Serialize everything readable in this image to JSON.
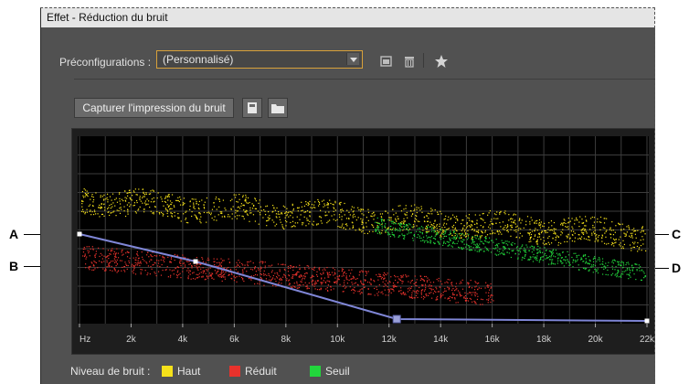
{
  "window": {
    "title": "Effet - Réduction du bruit"
  },
  "presets": {
    "label": "Préconfigurations :",
    "value": "(Personnalisé)"
  },
  "toolbar": {
    "icons": [
      "save-preset-icon",
      "delete-preset-icon",
      "favorite-star-icon"
    ]
  },
  "capture": {
    "label": "Capturer l'impression du bruit",
    "icons": [
      "save-file-icon",
      "open-folder-icon"
    ]
  },
  "callouts": [
    "A",
    "B",
    "C",
    "D"
  ],
  "legend": {
    "label": "Niveau de bruit :",
    "items": [
      {
        "label": "Haut",
        "color": "#f5e11a"
      },
      {
        "label": "Réduit",
        "color": "#e8322c"
      },
      {
        "label": "Seuil",
        "color": "#22d63c"
      }
    ]
  },
  "colors": {
    "panel": "#515151",
    "graph_bg": "#000000",
    "grid": "#3c3c3c",
    "curve": "#7f86d6",
    "accent_border": "#d8a13a"
  },
  "chart_data": {
    "type": "scatter",
    "x_unit": "Hz",
    "x_ticks": [
      "Hz",
      "2k",
      "4k",
      "6k",
      "8k",
      "10k",
      "12k",
      "14k",
      "16k",
      "18k",
      "20k",
      "22k"
    ],
    "xlim": [
      0,
      22000
    ],
    "grid": true,
    "series": [
      {
        "name": "Haut",
        "color": "#f5e11a"
      },
      {
        "name": "Réduit",
        "color": "#e8322c"
      },
      {
        "name": "Seuil",
        "color": "#22d63c"
      }
    ],
    "reduction_curve": {
      "color": "#7f86d6",
      "points_hz": [
        0,
        4500,
        12300,
        22000
      ]
    }
  }
}
